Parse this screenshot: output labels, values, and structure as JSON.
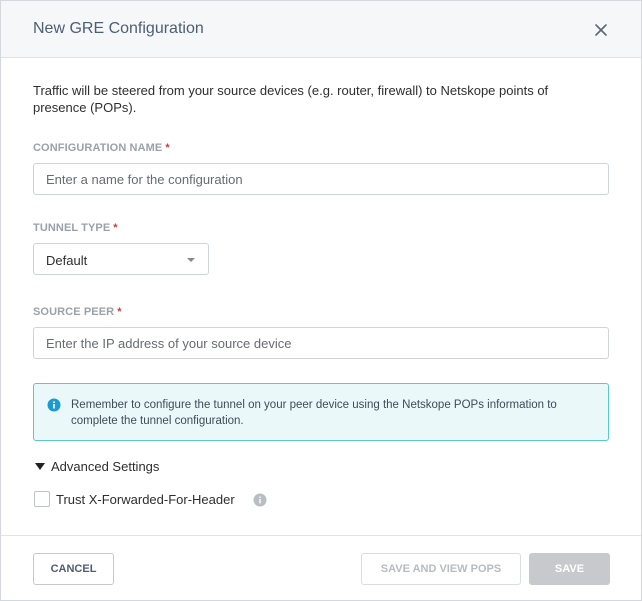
{
  "dialog": {
    "title": "New GRE Configuration",
    "description": "Traffic will be steered from your source devices (e.g. router, firewall) to Netskope points of presence (POPs)."
  },
  "fields": {
    "config_name": {
      "label": "CONFIGURATION NAME",
      "required_mark": "*",
      "placeholder": "Enter a name for the configuration",
      "value": ""
    },
    "tunnel_type": {
      "label": "TUNNEL TYPE",
      "required_mark": "*",
      "selected": "Default"
    },
    "source_peer": {
      "label": "SOURCE PEER",
      "required_mark": "*",
      "placeholder": "Enter the IP address of your source device",
      "value": ""
    }
  },
  "info": {
    "text": "Remember to configure the tunnel on your peer device using the Netskope POPs information to complete the tunnel configuration."
  },
  "advanced": {
    "label": "Advanced Settings",
    "expanded": true,
    "trust_xff": {
      "label": "Trust X-Forwarded-For-Header",
      "checked": false
    }
  },
  "footer": {
    "cancel_label": "CANCEL",
    "save_view_label": "SAVE AND VIEW POPS",
    "save_label": "SAVE"
  },
  "icons": {
    "close": "close-icon",
    "info": "info-icon",
    "hint": "info-circle-icon",
    "dropdown": "caret-down-icon",
    "advanced": "caret-down-icon"
  },
  "colors": {
    "info_border": "#5cc6d2",
    "info_bg": "#eaf8fa",
    "required": "#d0383e",
    "title": "#4c5f73"
  }
}
